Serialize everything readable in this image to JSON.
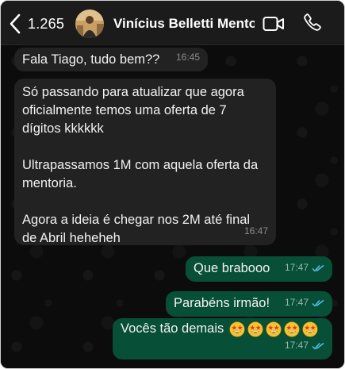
{
  "header": {
    "back_count": "1.265",
    "contact_name": "Vinícius Belletti Mento...",
    "icons": [
      "chevron-left-icon",
      "video-call-icon",
      "phone-icon"
    ]
  },
  "messages": [
    {
      "direction": "incoming",
      "text": "Fala Tiago, tudo bem??",
      "time": "16:45"
    },
    {
      "direction": "incoming",
      "text": "Só passando para atualizar que agora\noficialmente temos uma oferta de 7\ndígitos kkkkkk\n\nUltrapassamos 1M com aquela oferta da\nmentoria.\n\nAgora a ideia é chegar nos 2M até final\nde Abril heheheh",
      "time": "16:47"
    },
    {
      "direction": "outgoing",
      "text": "Que brabooo",
      "time": "17:47",
      "status": "read"
    },
    {
      "direction": "outgoing",
      "text": "Parabéns irmão!",
      "time": "17:47",
      "status": "read"
    },
    {
      "direction": "outgoing",
      "text": "Vocês tão demais",
      "emoji": "star-struck",
      "emoji_count": 5,
      "time": "17:47",
      "status": "read"
    }
  ],
  "colors": {
    "header_bg": "#1b1b1b",
    "chat_bg": "#0c0c0c",
    "incoming_bubble": "#222222",
    "outgoing_bubble": "#074f37",
    "read_ticks": "#53bdeb"
  }
}
